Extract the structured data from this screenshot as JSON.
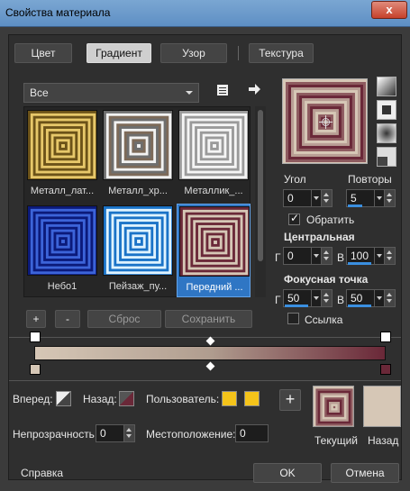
{
  "window": {
    "title": "Свойства материала",
    "close_glyph": "x"
  },
  "tabs": [
    {
      "label": "Цвет",
      "active": false
    },
    {
      "label": "Градиент",
      "active": true
    },
    {
      "label": "Узор",
      "active": false
    },
    {
      "label": "Текстура",
      "active": false
    }
  ],
  "category": {
    "selected": "Все"
  },
  "gallery": {
    "items": [
      {
        "caption": "Металл_лат...",
        "palette": [
          "#6b5218",
          "#e7c86a"
        ],
        "selected": false
      },
      {
        "caption": "Металл_хр...",
        "palette": [
          "#6e6e6e",
          "#f2f2f2",
          "#7d6a59"
        ],
        "selected": false
      },
      {
        "caption": "Металлик_...",
        "palette": [
          "#9a9a9a",
          "#f5f5f5"
        ],
        "selected": false
      },
      {
        "caption": "Небо1",
        "palette": [
          "#0b1a7a",
          "#3c64d9"
        ],
        "selected": false
      },
      {
        "caption": "Пейзаж_пу...",
        "palette": [
          "#1a73c7",
          "#dff3ff"
        ],
        "selected": false
      },
      {
        "caption": "Передний ...",
        "palette": [
          "#6a2838",
          "#d6c7b6"
        ],
        "selected": true
      }
    ]
  },
  "gallery_buttons": {
    "add": "+",
    "remove": "-",
    "reset": "Сброс",
    "save": "Сохранить"
  },
  "gradient": {
    "colors": [
      "#d6c7b6",
      "#6a2838"
    ],
    "angle_label": "Угол",
    "angle": "0",
    "repeats_label": "Повторы",
    "repeats": "5",
    "invert_label": "Обратить",
    "invert": true,
    "center_label": "Центральная",
    "center_h_label": "Г",
    "center_h": "0",
    "center_v_label": "В",
    "center_v": "100",
    "focal_label": "Фокусная точка",
    "focal_h_label": "Г",
    "focal_h": "50",
    "focal_v_label": "В",
    "focal_v": "50",
    "link_label": "Ссылка",
    "link": false
  },
  "bottom": {
    "forward_label": "Вперед:",
    "back_label": "Назад:",
    "user_label": "Пользователь:",
    "user_colors": [
      "#f5c41a",
      "#f5c41a"
    ],
    "opacity_label": "Непрозрачность:",
    "opacity": "0",
    "location_label": "Местоположение:",
    "location": "0",
    "add_glyph": "+",
    "current_label": "Текущий",
    "back_swatch_label": "Назад",
    "back_swatch_color": "#d6c7b6"
  },
  "footer": {
    "help": "Справка",
    "ok": "OK",
    "cancel": "Отмена"
  }
}
